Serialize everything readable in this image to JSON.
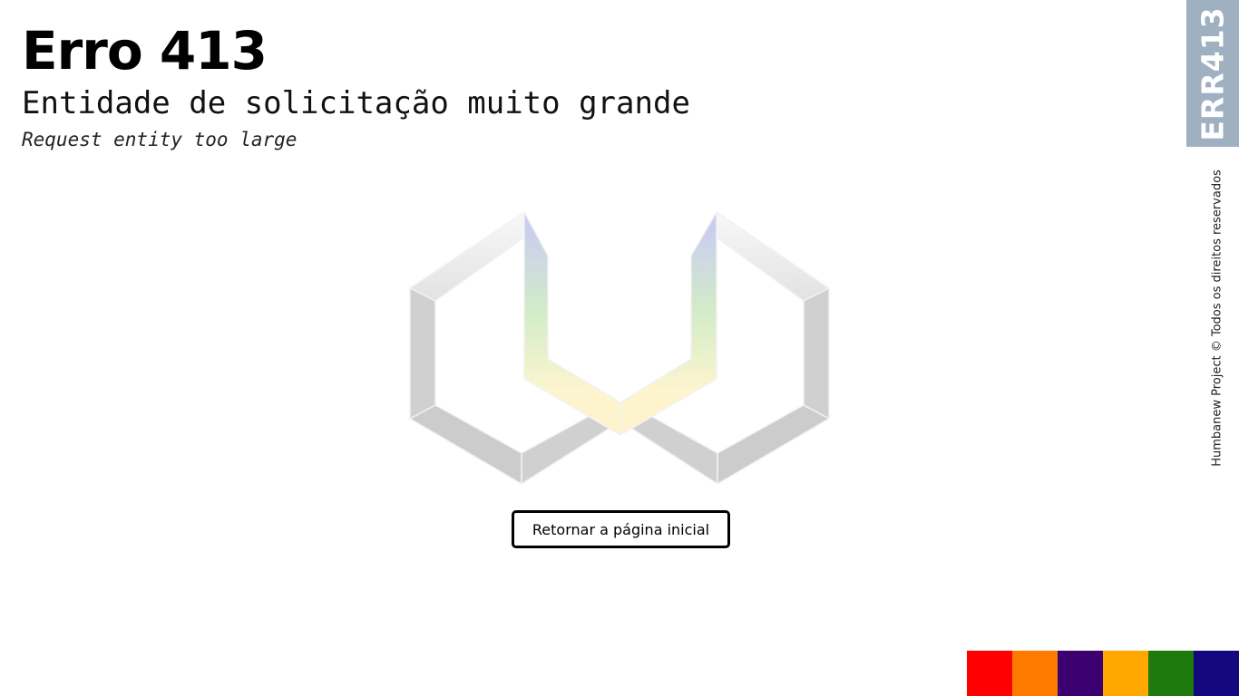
{
  "header": {
    "title": "Erro 413",
    "subtitle": "Entidade de solicitação muito grande",
    "subtitle_en": "Request entity too large"
  },
  "side": {
    "code": "ERR413",
    "code_tab_color": "#9fb0c1",
    "copyright": "Humbanew Project © Todos os direitos reservados"
  },
  "actions": {
    "home_button": "Retornar a página inicial"
  },
  "logo": {
    "icon": "double-hexagon-logo-icon",
    "frame_color": "#d0d0d0",
    "gradient_colors": [
      "#c8c8f6",
      "#d2ecc8",
      "#fdf5cf"
    ]
  },
  "palette": [
    "#ff0000",
    "#ff7b00",
    "#3d0070",
    "#ffa800",
    "#1e7a0c",
    "#14087e"
  ]
}
